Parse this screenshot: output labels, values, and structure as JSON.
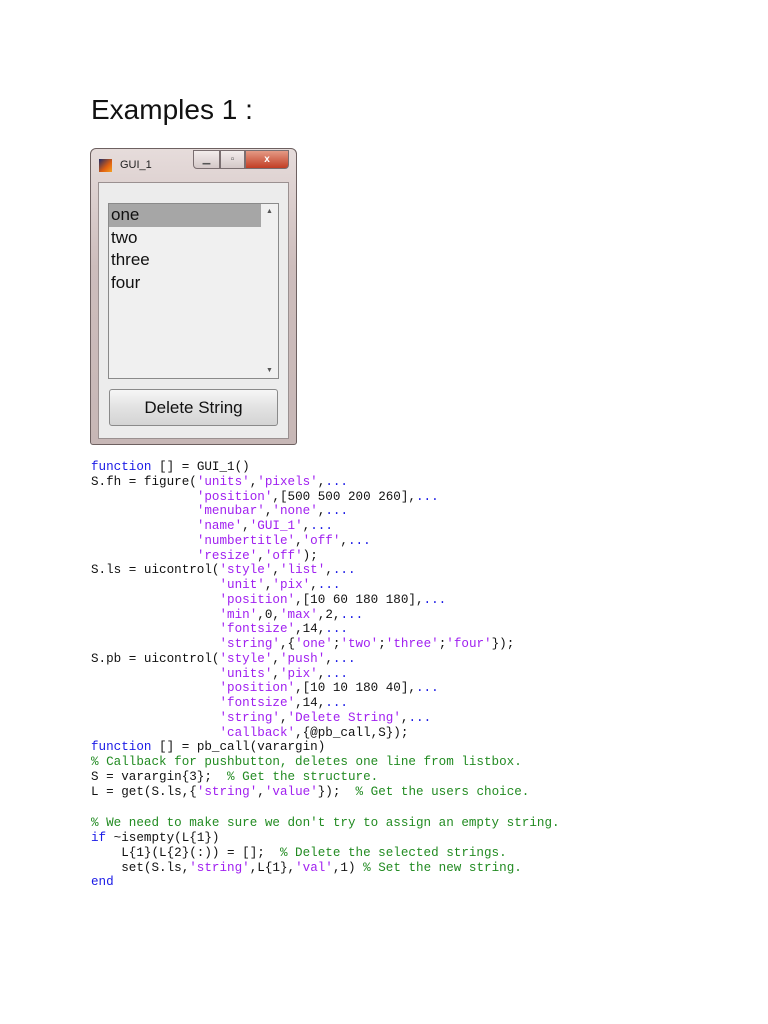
{
  "heading": "Examples 1 :",
  "window": {
    "title": "GUI_1",
    "list_items": [
      "one",
      "two",
      "three",
      "four"
    ],
    "selected_index": 0,
    "button_label": "Delete String",
    "close_glyph": "x"
  },
  "code_lines": [
    [
      [
        "k",
        "function"
      ],
      [
        "n",
        " [] = GUI_1()"
      ]
    ],
    [
      [
        "n",
        "S.fh = figure("
      ],
      [
        "s",
        "'units'"
      ],
      [
        "n",
        ","
      ],
      [
        "s",
        "'pixels'"
      ],
      [
        "n",
        ","
      ],
      [
        "k",
        "..."
      ]
    ],
    [
      [
        "n",
        "              "
      ],
      [
        "s",
        "'position'"
      ],
      [
        "n",
        ",[500 500 200 260],"
      ],
      [
        "k",
        "..."
      ]
    ],
    [
      [
        "n",
        "              "
      ],
      [
        "s",
        "'menubar'"
      ],
      [
        "n",
        ","
      ],
      [
        "s",
        "'none'"
      ],
      [
        "n",
        ","
      ],
      [
        "k",
        "..."
      ]
    ],
    [
      [
        "n",
        "              "
      ],
      [
        "s",
        "'name'"
      ],
      [
        "n",
        ","
      ],
      [
        "s",
        "'GUI_1'"
      ],
      [
        "n",
        ","
      ],
      [
        "k",
        "..."
      ]
    ],
    [
      [
        "n",
        "              "
      ],
      [
        "s",
        "'numbertitle'"
      ],
      [
        "n",
        ","
      ],
      [
        "s",
        "'off'"
      ],
      [
        "n",
        ","
      ],
      [
        "k",
        "..."
      ]
    ],
    [
      [
        "n",
        "              "
      ],
      [
        "s",
        "'resize'"
      ],
      [
        "n",
        ","
      ],
      [
        "s",
        "'off'"
      ],
      [
        "n",
        ");"
      ]
    ],
    [
      [
        "n",
        "S.ls = uicontrol("
      ],
      [
        "s",
        "'style'"
      ],
      [
        "n",
        ","
      ],
      [
        "s",
        "'list'"
      ],
      [
        "n",
        ","
      ],
      [
        "k",
        "..."
      ]
    ],
    [
      [
        "n",
        "                 "
      ],
      [
        "s",
        "'unit'"
      ],
      [
        "n",
        ","
      ],
      [
        "s",
        "'pix'"
      ],
      [
        "n",
        ","
      ],
      [
        "k",
        "..."
      ]
    ],
    [
      [
        "n",
        "                 "
      ],
      [
        "s",
        "'position'"
      ],
      [
        "n",
        ",[10 60 180 180],"
      ],
      [
        "k",
        "..."
      ]
    ],
    [
      [
        "n",
        "                 "
      ],
      [
        "s",
        "'min'"
      ],
      [
        "n",
        ",0,"
      ],
      [
        "s",
        "'max'"
      ],
      [
        "n",
        ",2,"
      ],
      [
        "k",
        "..."
      ]
    ],
    [
      [
        "n",
        "                 "
      ],
      [
        "s",
        "'fontsize'"
      ],
      [
        "n",
        ",14,"
      ],
      [
        "k",
        "..."
      ]
    ],
    [
      [
        "n",
        "                 "
      ],
      [
        "s",
        "'string'"
      ],
      [
        "n",
        ",{"
      ],
      [
        "s",
        "'one'"
      ],
      [
        "n",
        ";"
      ],
      [
        "s",
        "'two'"
      ],
      [
        "n",
        ";"
      ],
      [
        "s",
        "'three'"
      ],
      [
        "n",
        ";"
      ],
      [
        "s",
        "'four'"
      ],
      [
        "n",
        "});"
      ]
    ],
    [
      [
        "n",
        "S.pb = uicontrol("
      ],
      [
        "s",
        "'style'"
      ],
      [
        "n",
        ","
      ],
      [
        "s",
        "'push'"
      ],
      [
        "n",
        ","
      ],
      [
        "k",
        "..."
      ]
    ],
    [
      [
        "n",
        "                 "
      ],
      [
        "s",
        "'units'"
      ],
      [
        "n",
        ","
      ],
      [
        "s",
        "'pix'"
      ],
      [
        "n",
        ","
      ],
      [
        "k",
        "..."
      ]
    ],
    [
      [
        "n",
        "                 "
      ],
      [
        "s",
        "'position'"
      ],
      [
        "n",
        ",[10 10 180 40],"
      ],
      [
        "k",
        "..."
      ]
    ],
    [
      [
        "n",
        "                 "
      ],
      [
        "s",
        "'fontsize'"
      ],
      [
        "n",
        ",14,"
      ],
      [
        "k",
        "..."
      ]
    ],
    [
      [
        "n",
        "                 "
      ],
      [
        "s",
        "'string'"
      ],
      [
        "n",
        ","
      ],
      [
        "s",
        "'Delete String'"
      ],
      [
        "n",
        ","
      ],
      [
        "k",
        "..."
      ]
    ],
    [
      [
        "n",
        "                 "
      ],
      [
        "s",
        "'callback'"
      ],
      [
        "n",
        ",{@pb_call,S});"
      ]
    ],
    [
      [
        "k",
        "function"
      ],
      [
        "n",
        " [] = pb_call(varargin)"
      ]
    ],
    [
      [
        "c",
        "% Callback for pushbutton, deletes one line from listbox."
      ]
    ],
    [
      [
        "n",
        "S = varargin{3};  "
      ],
      [
        "c",
        "% Get the structure."
      ]
    ],
    [
      [
        "n",
        "L = get(S.ls,{"
      ],
      [
        "s",
        "'string'"
      ],
      [
        "n",
        ","
      ],
      [
        "s",
        "'value'"
      ],
      [
        "n",
        "});  "
      ],
      [
        "c",
        "% Get the users choice."
      ]
    ],
    [],
    [
      [
        "c",
        "% We need to make sure we don't try to assign an empty string."
      ]
    ],
    [
      [
        "k",
        "if"
      ],
      [
        "n",
        " ~isempty(L{1})"
      ]
    ],
    [
      [
        "n",
        "    L{1}(L{2}(:)) = [];  "
      ],
      [
        "c",
        "% Delete the selected strings."
      ]
    ],
    [
      [
        "n",
        "    set(S.ls,"
      ],
      [
        "s",
        "'string'"
      ],
      [
        "n",
        ",L{1},"
      ],
      [
        "s",
        "'val'"
      ],
      [
        "n",
        ",1) "
      ],
      [
        "c",
        "% Set the new string."
      ]
    ],
    [
      [
        "k",
        "end"
      ]
    ]
  ]
}
